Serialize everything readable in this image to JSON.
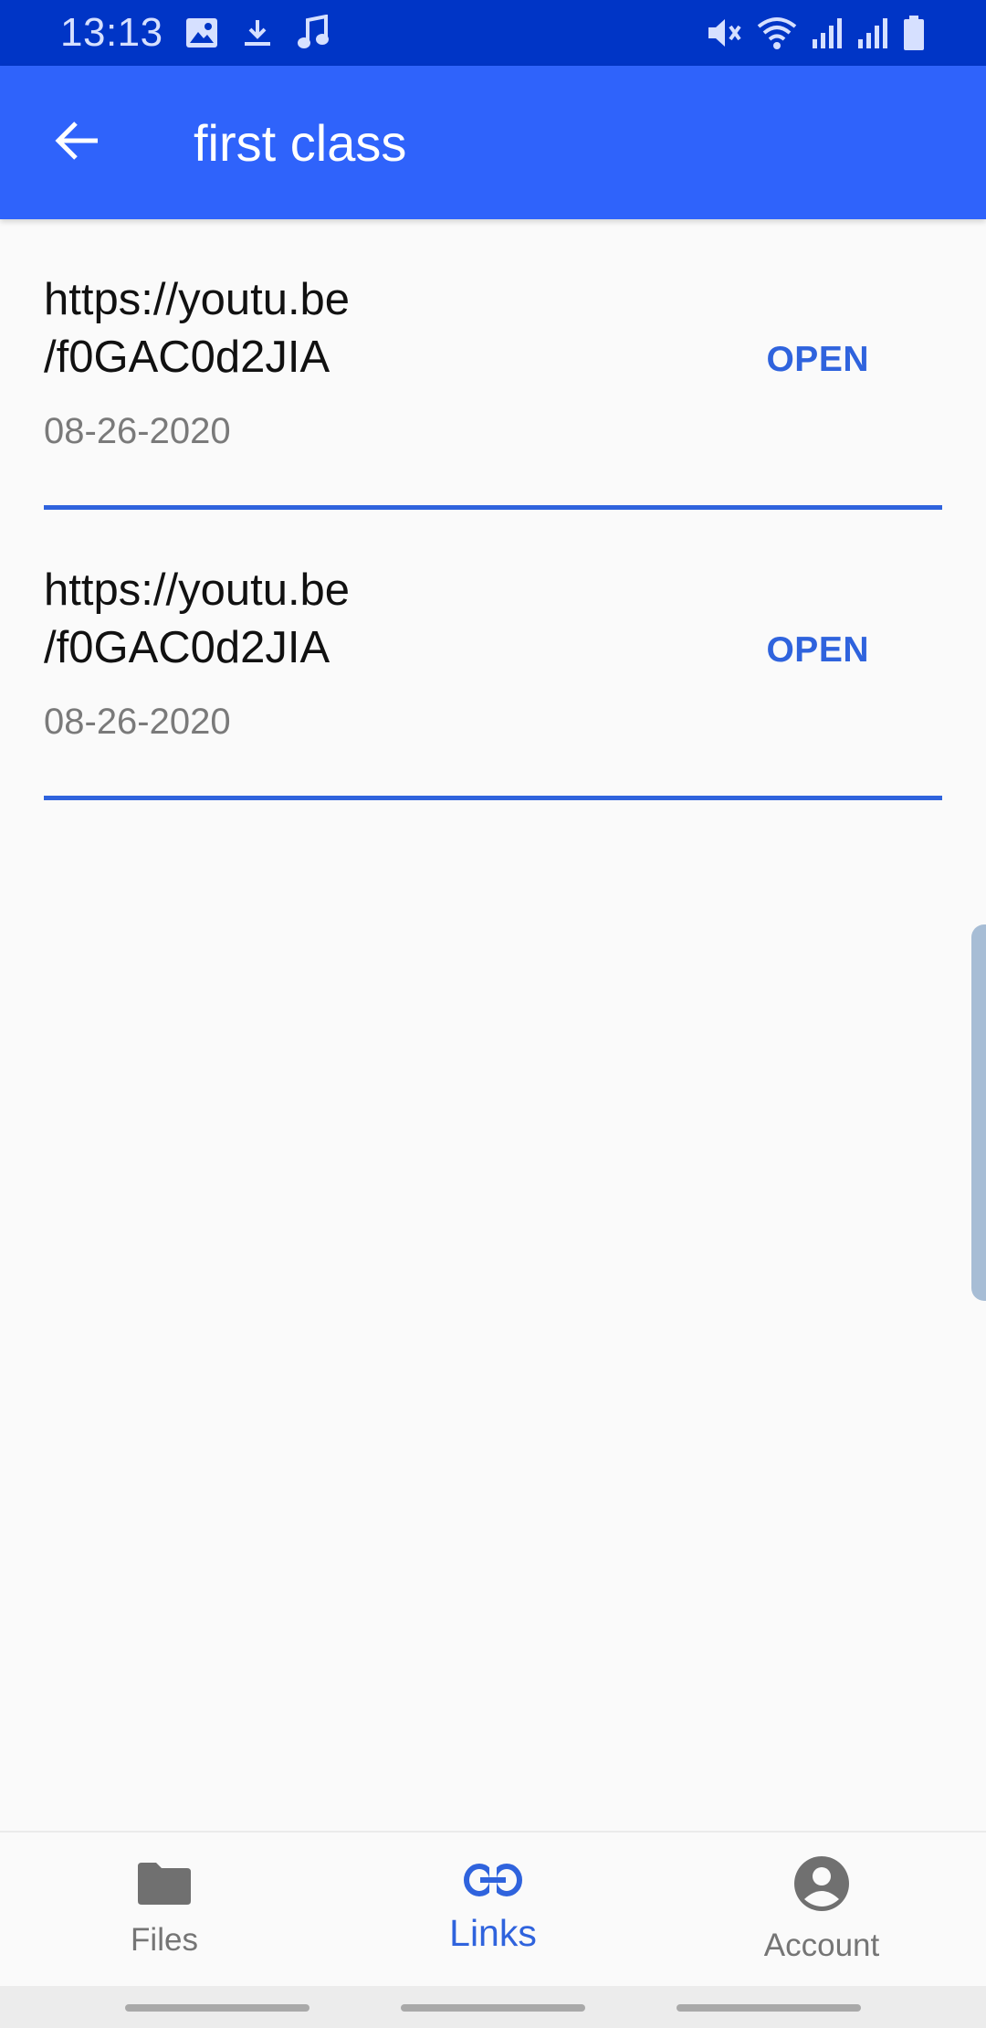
{
  "status_bar": {
    "time": "13:13",
    "left_icons": [
      "image-icon",
      "download-icon",
      "music-note-icon"
    ],
    "right_icons": [
      "mute-icon",
      "wifi-icon",
      "signal-icon",
      "signal-icon",
      "battery-icon"
    ]
  },
  "app_bar": {
    "back_icon": "arrow-back-icon",
    "title": "first class"
  },
  "links": [
    {
      "url": "https://youtu.be\n/f0GAC0d2JIA",
      "date": "08-26-2020",
      "action": "OPEN"
    },
    {
      "url": "https://youtu.be\n/f0GAC0d2JIA",
      "date": "08-26-2020",
      "action": "OPEN"
    }
  ],
  "bottom_nav": {
    "items": [
      {
        "label": "Files",
        "icon": "folder-icon",
        "active": false
      },
      {
        "label": "Links",
        "icon": "link-icon",
        "active": true
      },
      {
        "label": "Account",
        "icon": "account-circle-icon",
        "active": false
      }
    ]
  },
  "colors": {
    "status_bar": "#0035c6",
    "app_bar": "#2f63fb",
    "accent": "#2f63dd"
  }
}
